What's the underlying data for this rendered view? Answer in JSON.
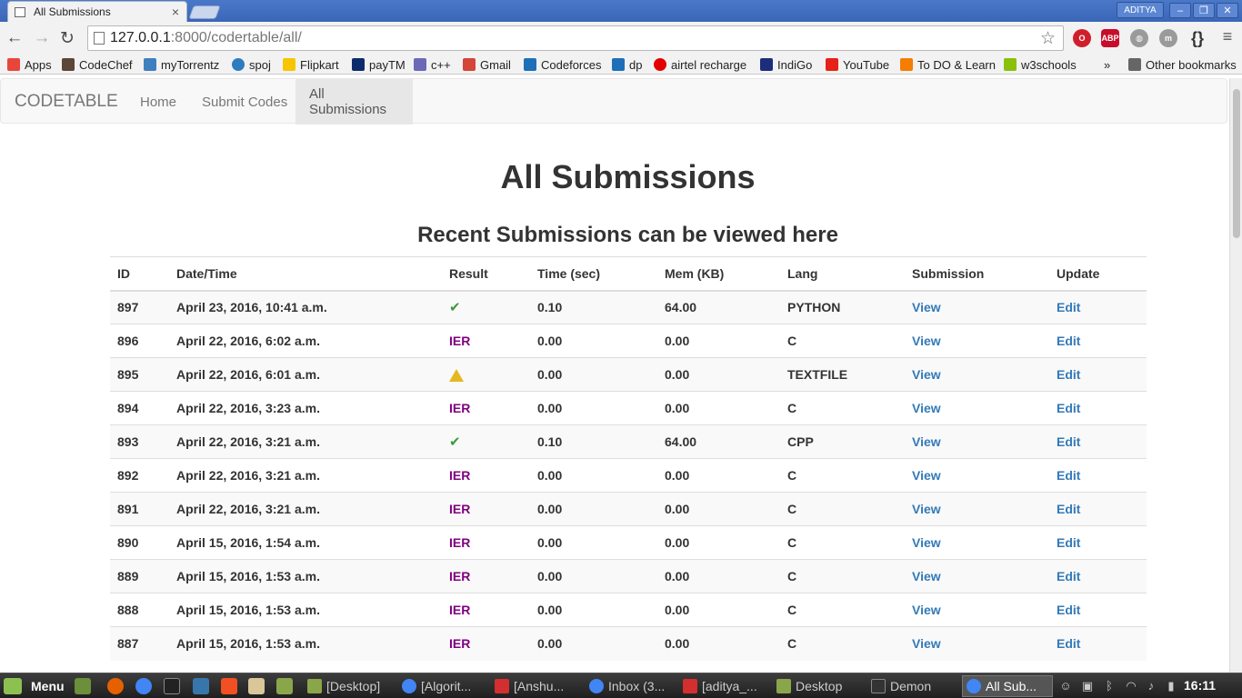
{
  "browser": {
    "tab_title": "All Submissions",
    "tab_close": "×",
    "user_name": "ADITYA",
    "window_buttons": [
      "‒",
      "❐",
      "✕"
    ],
    "url_host": "127.0.0.1",
    "url_rest": ":8000/codertable/all/",
    "bookmarks": [
      {
        "label": "Apps",
        "color": "#e8453c"
      },
      {
        "label": "CodeChef",
        "color": "#5b4638"
      },
      {
        "label": "myTorrentz",
        "color": "#3f7fbf"
      },
      {
        "label": "spoj",
        "color": "#2f7bbf"
      },
      {
        "label": "Flipkart",
        "color": "#f6c500"
      },
      {
        "label": "payTM",
        "color": "#0d2b6b"
      },
      {
        "label": "c++",
        "color": "#6a6ab8"
      },
      {
        "label": "Gmail",
        "color": "#d44638"
      },
      {
        "label": "Codeforces",
        "color": "#1d6fb8"
      },
      {
        "label": "dp",
        "color": "#1d6fb8"
      },
      {
        "label": "airtel recharge",
        "color": "#e40000"
      },
      {
        "label": "IndiGo",
        "color": "#1b2d7b"
      },
      {
        "label": "YouTube",
        "color": "#e62117"
      },
      {
        "label": "To DO & Learn",
        "color": "#f57d00"
      },
      {
        "label": "w3schools",
        "color": "#8ac007"
      }
    ],
    "bookmarks_more": "»",
    "other_bookmarks": "Other bookmarks"
  },
  "navbar": {
    "brand": "CODETABLE",
    "links": [
      "Home",
      "Submit Codes",
      "All Submissions"
    ]
  },
  "page": {
    "title": "All Submissions",
    "subtitle": "Recent Submissions can be viewed here"
  },
  "table": {
    "headers": [
      "ID",
      "Date/Time",
      "Result",
      "Time (sec)",
      "Mem (KB)",
      "Lang",
      "Submission",
      "Update"
    ],
    "rows": [
      {
        "id": "897",
        "datetime": "April 23, 2016, 10:41 a.m.",
        "result": "ok",
        "time": "0.10",
        "mem": "64.00",
        "lang": "PYTHON",
        "view": "View",
        "edit": "Edit"
      },
      {
        "id": "896",
        "datetime": "April 22, 2016, 6:02 a.m.",
        "result": "IER",
        "time": "0.00",
        "mem": "0.00",
        "lang": "C",
        "view": "View",
        "edit": "Edit"
      },
      {
        "id": "895",
        "datetime": "April 22, 2016, 6:01 a.m.",
        "result": "warning",
        "time": "0.00",
        "mem": "0.00",
        "lang": "TEXTFILE",
        "view": "View",
        "edit": "Edit"
      },
      {
        "id": "894",
        "datetime": "April 22, 2016, 3:23 a.m.",
        "result": "IER",
        "time": "0.00",
        "mem": "0.00",
        "lang": "C",
        "view": "View",
        "edit": "Edit"
      },
      {
        "id": "893",
        "datetime": "April 22, 2016, 3:21 a.m.",
        "result": "ok",
        "time": "0.10",
        "mem": "64.00",
        "lang": "CPP",
        "view": "View",
        "edit": "Edit"
      },
      {
        "id": "892",
        "datetime": "April 22, 2016, 3:21 a.m.",
        "result": "IER",
        "time": "0.00",
        "mem": "0.00",
        "lang": "C",
        "view": "View",
        "edit": "Edit"
      },
      {
        "id": "891",
        "datetime": "April 22, 2016, 3:21 a.m.",
        "result": "IER",
        "time": "0.00",
        "mem": "0.00",
        "lang": "C",
        "view": "View",
        "edit": "Edit"
      },
      {
        "id": "890",
        "datetime": "April 15, 2016, 1:54 a.m.",
        "result": "IER",
        "time": "0.00",
        "mem": "0.00",
        "lang": "C",
        "view": "View",
        "edit": "Edit"
      },
      {
        "id": "889",
        "datetime": "April 15, 2016, 1:53 a.m.",
        "result": "IER",
        "time": "0.00",
        "mem": "0.00",
        "lang": "C",
        "view": "View",
        "edit": "Edit"
      },
      {
        "id": "888",
        "datetime": "April 15, 2016, 1:53 a.m.",
        "result": "IER",
        "time": "0.00",
        "mem": "0.00",
        "lang": "C",
        "view": "View",
        "edit": "Edit"
      },
      {
        "id": "887",
        "datetime": "April 15, 2016, 1:53 a.m.",
        "result": "IER",
        "time": "0.00",
        "mem": "0.00",
        "lang": "C",
        "view": "View",
        "edit": "Edit"
      }
    ],
    "ok_glyph": "✔"
  },
  "taskbar": {
    "menu_label": "Menu",
    "tasks": [
      {
        "label": "[Desktop]",
        "color": "#8aa64a"
      },
      {
        "label": "[Algorit...",
        "color": "#4285f4"
      },
      {
        "label": "[Anshu...",
        "color": "#d32f2f"
      },
      {
        "label": "Inbox (3...",
        "color": "#4285f4"
      },
      {
        "label": "[aditya_...",
        "color": "#d32f2f"
      },
      {
        "label": "Desktop",
        "color": "#8aa64a"
      },
      {
        "label": "Demon",
        "color": "#333333"
      },
      {
        "label": "All Sub...",
        "color": "#4285f4"
      }
    ],
    "clock": "16:11"
  },
  "colors": {
    "ier": "#800080",
    "link": "#337ab7",
    "ok": "#3c9a3c",
    "warning": "#e6b820"
  }
}
